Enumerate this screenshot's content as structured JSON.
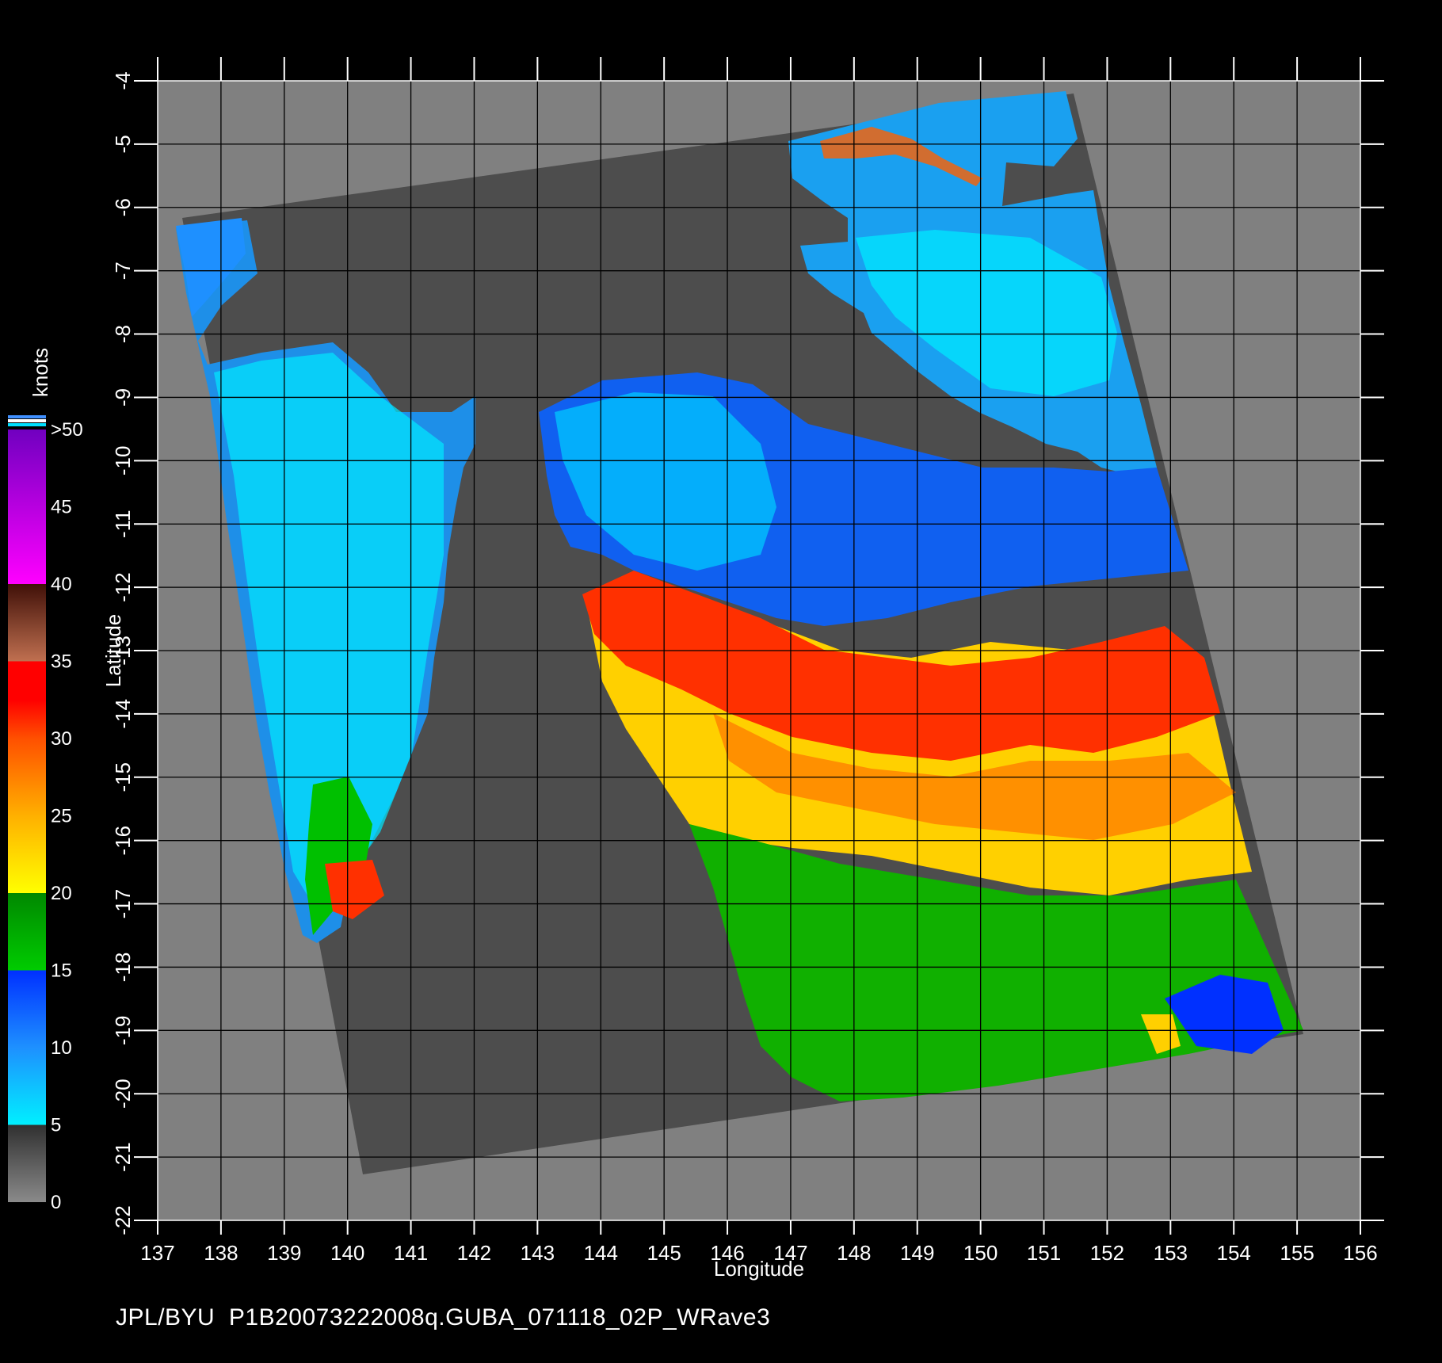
{
  "map": {
    "xlabel": "Longitude",
    "ylabel": "Latitude",
    "lon_ticks": [
      137,
      138,
      139,
      140,
      141,
      142,
      143,
      144,
      145,
      146,
      147,
      148,
      149,
      150,
      151,
      152,
      153,
      154,
      155,
      156
    ],
    "lat_ticks": [
      -4,
      -5,
      -6,
      -7,
      -8,
      -9,
      -10,
      -11,
      -12,
      -13,
      -14,
      -15,
      -16,
      -17,
      -18,
      -19,
      -20,
      -21,
      -22
    ],
    "lon_range": [
      137,
      156
    ],
    "lat_range": [
      -22,
      -4
    ],
    "grid": true,
    "colors": {
      "background": "#000000",
      "land_nodata": "#808080",
      "swath_nodata": "#4d4d4d",
      "grid": "#000000",
      "axes": "#ffffff"
    }
  },
  "colorbar": {
    "title": "knots",
    "labels": [
      "0",
      "5",
      "10",
      "15",
      "20",
      "25",
      "30",
      "35",
      "40",
      "45",
      ">50"
    ],
    "stops": [
      {
        "value": 0,
        "color": "#8a8a8a"
      },
      {
        "value": 5,
        "color": "#303030"
      },
      {
        "value": 5,
        "color": "#00f0ff"
      },
      {
        "value": 10,
        "color": "#1e90ff"
      },
      {
        "value": 15,
        "color": "#0030ff"
      },
      {
        "value": 15,
        "color": "#00cc00"
      },
      {
        "value": 20,
        "color": "#008800"
      },
      {
        "value": 20,
        "color": "#ffff00"
      },
      {
        "value": 25,
        "color": "#ffb000"
      },
      {
        "value": 30,
        "color": "#ff5000"
      },
      {
        "value": 32.5,
        "color": "#ff0000"
      },
      {
        "value": 35,
        "color": "#ff0000"
      },
      {
        "value": 35,
        "color": "#c07050"
      },
      {
        "value": 40,
        "color": "#401008"
      },
      {
        "value": 40,
        "color": "#ff00ff"
      },
      {
        "value": 50,
        "color": "#7000c0"
      }
    ]
  },
  "footer": {
    "credit": "JPL/BYU  P1B20073222008q.GUBA_071118_02P_WRave3"
  }
}
